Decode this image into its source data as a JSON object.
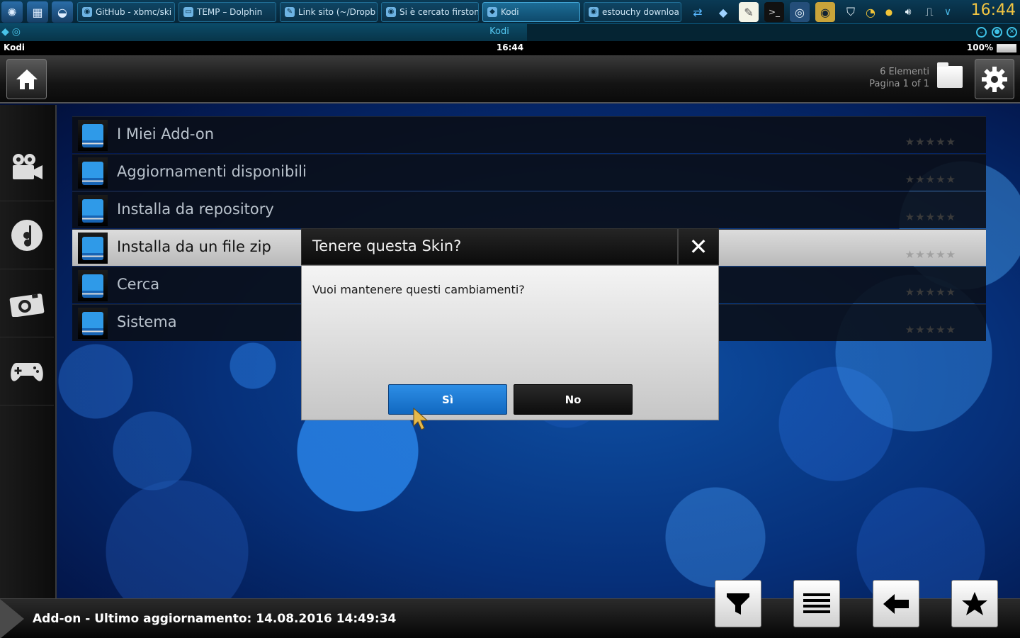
{
  "taskbar": {
    "tasks": [
      {
        "label": "GitHub - xbmc/ski"
      },
      {
        "label": "TEMP – Dolphin"
      },
      {
        "label": "Link sito (~/Dropb"
      },
      {
        "label": "Si è cercato firston"
      },
      {
        "label": "Kodi"
      },
      {
        "label": "estouchy downloa"
      }
    ],
    "clock": "16:44"
  },
  "window": {
    "title": "Kodi"
  },
  "kodi_status": {
    "app": "Kodi",
    "time": "16:44",
    "battery": "100%"
  },
  "header": {
    "items_count": "6 Elementi",
    "page": "Pagina 1 of 1"
  },
  "list": {
    "items": [
      {
        "label": "I Miei Add-on"
      },
      {
        "label": "Aggiornamenti disponibili"
      },
      {
        "label": "Installa da repository"
      },
      {
        "label": "Installa da un file zip"
      },
      {
        "label": "Cerca"
      },
      {
        "label": "Sistema"
      }
    ],
    "stars": "★★★★★"
  },
  "dialog": {
    "title": "Tenere questa Skin?",
    "message": "Vuoi mantenere questi cambiamenti?",
    "yes_label": "Sì",
    "no_label": "No"
  },
  "footer": {
    "status": "Add-on - Ultimo aggiornamento: 14.08.2016 14:49:34"
  },
  "colors": {
    "accent": "#1d7bd6",
    "selection": "#cfcfcf"
  }
}
